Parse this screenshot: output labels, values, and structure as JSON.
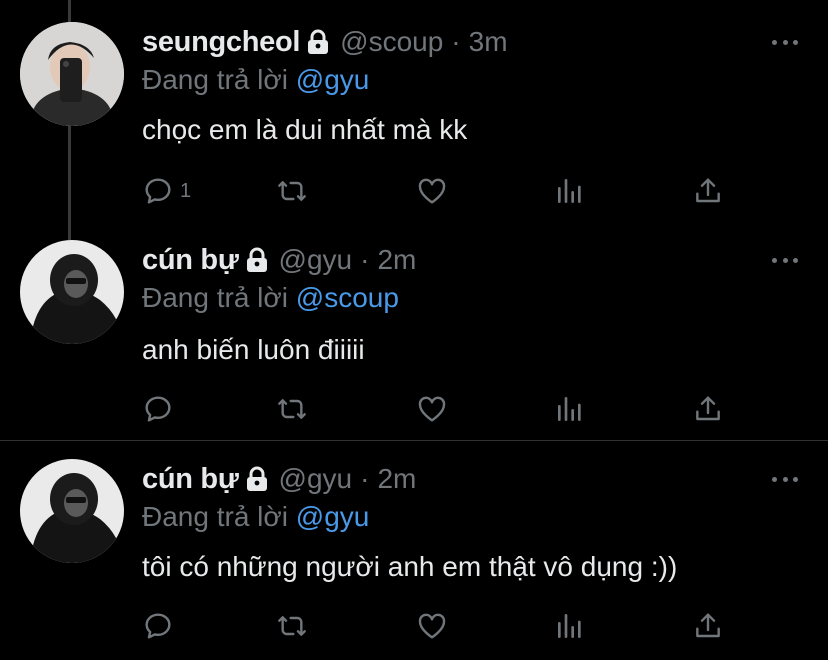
{
  "theme": {
    "background": "#000000",
    "text": "#e7e9ea",
    "muted": "#71767b",
    "link": "#4a99e9",
    "divider": "#2f3336"
  },
  "tweets": [
    {
      "display_name": "seungcheol",
      "handle": "@scoup",
      "separator": "·",
      "time": "3m",
      "reply_prefix": "Đang trả lời",
      "reply_to": "@gyu",
      "text": "chọc em là dui nhất mà kk",
      "reply_count": "1",
      "protected": true
    },
    {
      "display_name": "cún bự",
      "handle": "@gyu",
      "separator": "·",
      "time": "2m",
      "reply_prefix": "Đang trả lời",
      "reply_to": "@scoup",
      "text": "anh biến luôn điiiii",
      "reply_count": "",
      "protected": true
    },
    {
      "display_name": "cún bự",
      "handle": "@gyu",
      "separator": "·",
      "time": "2m",
      "reply_prefix": "Đang trả lời",
      "reply_to": "@gyu",
      "text": "tôi có những người anh em thật vô dụng :))",
      "reply_count": "",
      "protected": true
    }
  ],
  "icons": {
    "lock": "lock-icon",
    "more": "more-icon",
    "reply": "reply-icon",
    "retweet": "retweet-icon",
    "like": "heart-icon",
    "analytics": "analytics-icon",
    "share": "share-icon"
  }
}
